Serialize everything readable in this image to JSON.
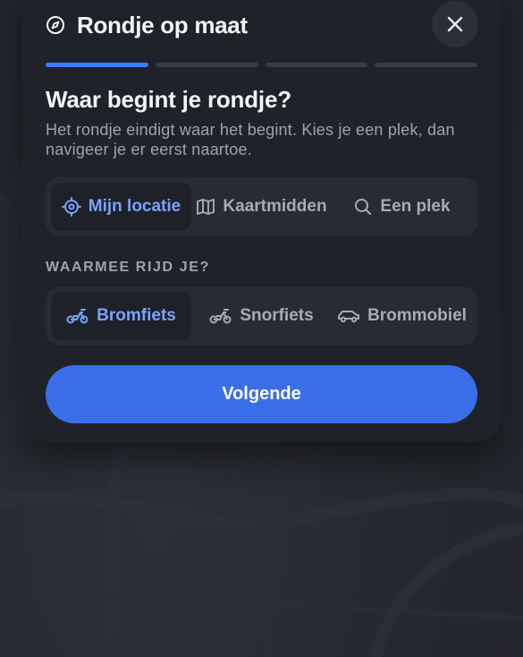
{
  "header": {
    "title": "Rondje op maat",
    "compass_icon": "compass-icon",
    "close_icon": "close-icon"
  },
  "progress": {
    "steps": 4,
    "current_step": 1,
    "active_color": "#3a7bff"
  },
  "question": {
    "title": "Waar begint je rondje?",
    "subtitle": "Het rondje eindigt waar het begint. Kies je een plek, dan navigeer je er eerst naartoe."
  },
  "start_options": [
    {
      "label": "Mijn locatie",
      "icon": "location-target-icon",
      "selected": true
    },
    {
      "label": "Kaartmidden",
      "icon": "map-icon",
      "selected": false
    },
    {
      "label": "Een plek",
      "icon": "search-icon",
      "selected": false
    }
  ],
  "vehicle": {
    "label": "WAARMEE RIJD JE?",
    "options": [
      {
        "label": "Bromfiets",
        "icon": "moped-icon",
        "selected": true
      },
      {
        "label": "Snorfiets",
        "icon": "scooter-icon",
        "selected": false
      },
      {
        "label": "Brommobiel",
        "icon": "microcar-icon",
        "selected": false
      }
    ]
  },
  "next_button": {
    "label": "Volgende",
    "color": "#3a6ee8"
  },
  "colors": {
    "selected_text": "#7aa3ff",
    "card_bg": "#1f2229"
  }
}
